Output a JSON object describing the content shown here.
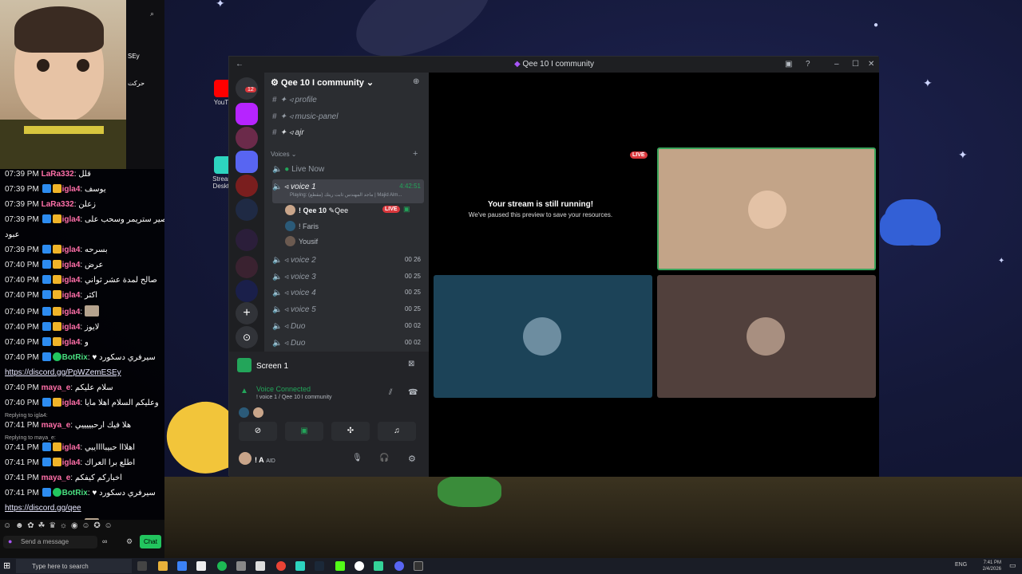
{
  "chat": {
    "messages": [
      {
        "time": "07:39 PM",
        "user": "LaRa332",
        "user_color": "#ff6fa8",
        "badges": [],
        "text": "قلل"
      },
      {
        "time": "07:39 PM",
        "user": "igla4",
        "user_color": "#ff6fa8",
        "badges": [
          "blue",
          "gold"
        ],
        "text": "يوسف"
      },
      {
        "time": "07:39 PM",
        "user": "LaRa332",
        "user_color": "#ff6fa8",
        "badges": [],
        "text": "زعلن"
      },
      {
        "time": "07:39 PM",
        "user": "igla4",
        "user_color": "#ff6fa8",
        "badges": [
          "blue",
          "gold"
        ],
        "text": "صير ستريمر وسحب على"
      },
      {
        "time": "",
        "user": "",
        "user_color": "#ffffff",
        "badges": [],
        "text": "عبود"
      },
      {
        "time": "07:39 PM",
        "user": "igla4",
        "user_color": "#ff6fa8",
        "badges": [
          "blue",
          "gold"
        ],
        "text": "بسرحه"
      },
      {
        "time": "07:40 PM",
        "user": "igla4",
        "user_color": "#ff6fa8",
        "badges": [
          "blue",
          "gold"
        ],
        "text": "عرض"
      },
      {
        "time": "07:40 PM",
        "user": "igla4",
        "user_color": "#ff6fa8",
        "badges": [
          "blue",
          "gold"
        ],
        "text": "صالح لمدة عشر ثواني"
      },
      {
        "time": "07:40 PM",
        "user": "igla4",
        "user_color": "#ff6fa8",
        "badges": [
          "blue",
          "gold"
        ],
        "text": "اكثر"
      },
      {
        "time": "07:40 PM",
        "user": "igla4",
        "user_color": "#ff6fa8",
        "badges": [
          "blue",
          "gold"
        ],
        "text": "",
        "sticker": true
      },
      {
        "time": "07:40 PM",
        "user": "igla4",
        "user_color": "#ff6fa8",
        "badges": [
          "blue",
          "gold"
        ],
        "text": "لايوز"
      },
      {
        "time": "07:40 PM",
        "user": "igla4",
        "user_color": "#ff6fa8",
        "badges": [
          "blue",
          "gold"
        ],
        "text": "و"
      },
      {
        "time": "07:40 PM",
        "user": "BotRix",
        "user_color": "#4ade80",
        "badges": [
          "blue",
          "green"
        ],
        "text": "♥ سيرفري دسكورد"
      },
      {
        "time": "",
        "user": "",
        "user_color": "#ffffff",
        "badges": [],
        "text": "https://discord.gg/PpWZemESEy",
        "link": true
      },
      {
        "time": "07:40 PM",
        "user": "maya_e",
        "user_color": "#ff6fa8",
        "badges": [],
        "text": "سلام عليكم"
      },
      {
        "time": "07:40 PM",
        "user": "igla4",
        "user_color": "#ff6fa8",
        "badges": [
          "blue",
          "gold"
        ],
        "text": "وعليكم السلام اهلا مايا"
      },
      {
        "reply": "Replying to igla4:"
      },
      {
        "time": "07:41 PM",
        "user": "maya_e",
        "user_color": "#ff6fa8",
        "badges": [],
        "text": "هلا فيك ارحبييييي"
      },
      {
        "reply": "Replying to maya_e:"
      },
      {
        "time": "07:41 PM",
        "user": "igla4",
        "user_color": "#ff6fa8",
        "badges": [
          "blue",
          "gold"
        ],
        "text": "اهلااا حبيباااايبي"
      },
      {
        "time": "07:41 PM",
        "user": "igla4",
        "user_color": "#ff6fa8",
        "badges": [
          "blue",
          "gold"
        ],
        "text": "اطلع برا العراك"
      },
      {
        "time": "07:41 PM",
        "user": "maya_e",
        "user_color": "#ff6fa8",
        "badges": [],
        "text": "اخباركم كيفكم"
      },
      {
        "time": "07:41 PM",
        "user": "BotRix",
        "user_color": "#4ade80",
        "badges": [
          "blue",
          "green"
        ],
        "text": "♥ سيرفري دسكورد"
      },
      {
        "time": "",
        "user": "",
        "user_color": "#ffffff",
        "badges": [],
        "text": "https://discord.gg/qee",
        "link": true
      },
      {
        "time": "07:41 PM",
        "user": "igla4",
        "user_color": "#ff6fa8",
        "badges": [
          "blue",
          "gold"
        ],
        "text": "",
        "sticker": true
      }
    ],
    "input_placeholder": "Send a message",
    "chat_button": "Chat"
  },
  "popup": {
    "label_right": "حركت",
    "sey": "SEy"
  },
  "desktop": {
    "icons": [
      {
        "label": "YouTu",
        "color": "#ff0000"
      },
      {
        "label": "Stream Deskto",
        "color": "#2dd4bf"
      }
    ]
  },
  "taskbar": {
    "search_placeholder": "Type here to search",
    "time": "7:41 PM",
    "date": "2/4/2026",
    "lang": "ENG"
  },
  "discord": {
    "title": "Qee 10 I community",
    "server_name": "Qee 10 I community",
    "unread_count": "12",
    "text_channels": [
      {
        "name": "profile"
      },
      {
        "name": "music-panel"
      },
      {
        "name": "ajr"
      }
    ],
    "voice_category": "Voices",
    "voice_channels": [
      {
        "name": "Live Now",
        "count": ""
      },
      {
        "name": "voice 1",
        "count": "4:42:51",
        "active": true,
        "playing": "Playing: (مقطع) ماجد المهندس ثابت ريتك | Majid Alm..."
      },
      {
        "name": "voice 2",
        "count": "00  26"
      },
      {
        "name": "voice 3",
        "count": "00  25"
      },
      {
        "name": "voice 4",
        "count": "00  25"
      },
      {
        "name": "voice 5",
        "count": "00  25"
      },
      {
        "name": "Duo",
        "count": "00  02"
      },
      {
        "name": "Duo",
        "count": "00  02"
      }
    ],
    "members": [
      {
        "name": "! Qee 10",
        "tag": "Qee",
        "live": "LIVE"
      },
      {
        "name": "! Faris"
      },
      {
        "name": "Yousif"
      }
    ],
    "screen_label": "Screen 1",
    "voice_connected": "Voice Connected",
    "voice_connected_sub": "! voice 1 / Qee 10 I community",
    "user_name": "! A",
    "user_status": "AID",
    "stream_note_title": "Your stream is still running!",
    "stream_note_sub": "We've paused this preview to save your resources.",
    "live_tag": "LIVE"
  }
}
